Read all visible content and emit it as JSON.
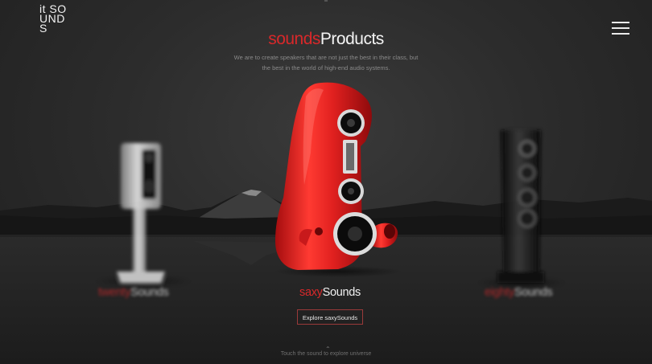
{
  "brand": {
    "logo_lines": [
      "it SO",
      "UND",
      "S"
    ]
  },
  "header": {
    "title_red": "sounds",
    "title_white": "Products",
    "subtitle_lines": [
      "We are to create speakers that are not just the best in their class, but",
      "the best in the world of high-end audio systems."
    ]
  },
  "products": {
    "left": {
      "name_red": "twenty",
      "name_white": "Sounds"
    },
    "center": {
      "name_red": "saxy",
      "name_white": "Sounds"
    },
    "right": {
      "name_red": "eighty",
      "name_white": "Sounds"
    }
  },
  "cta": {
    "label": "Explore saxySounds"
  },
  "footer": {
    "hint": "Touch the sound to explore universe"
  },
  "icons": {
    "menu": "hamburger-menu-icon",
    "chevron": "chevron-up-icon"
  },
  "colors": {
    "accent": "#d8282a",
    "background": "#2a2a2a"
  }
}
